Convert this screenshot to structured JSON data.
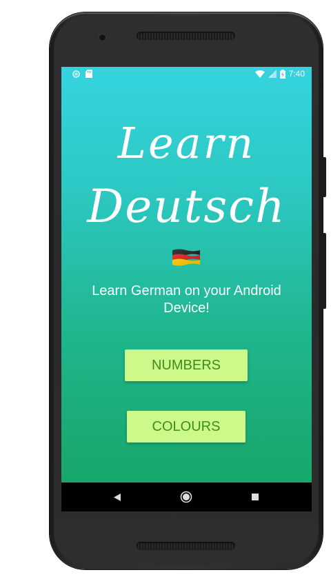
{
  "status_bar": {
    "time": "7:40",
    "left_icons": [
      "circle-notification-icon",
      "sd-card-icon"
    ],
    "right_icons": [
      "wifi-icon",
      "signal-icon",
      "battery-charging-icon"
    ]
  },
  "app": {
    "title_line1": "Learn",
    "title_line2": "Deutsch",
    "flag_icon": "german-flag-icon",
    "subtitle": "Learn German on your Android Device!",
    "buttons": {
      "numbers_label": "NUMBERS",
      "colours_label": "COLOURS"
    },
    "colors": {
      "gradient_top": "#35d3df",
      "gradient_bottom": "#18a76a",
      "button_background": "#ccf98a",
      "button_text": "#3e8c1e"
    }
  },
  "nav_bar": {
    "icons": [
      "back-icon",
      "home-icon",
      "recents-icon"
    ]
  }
}
